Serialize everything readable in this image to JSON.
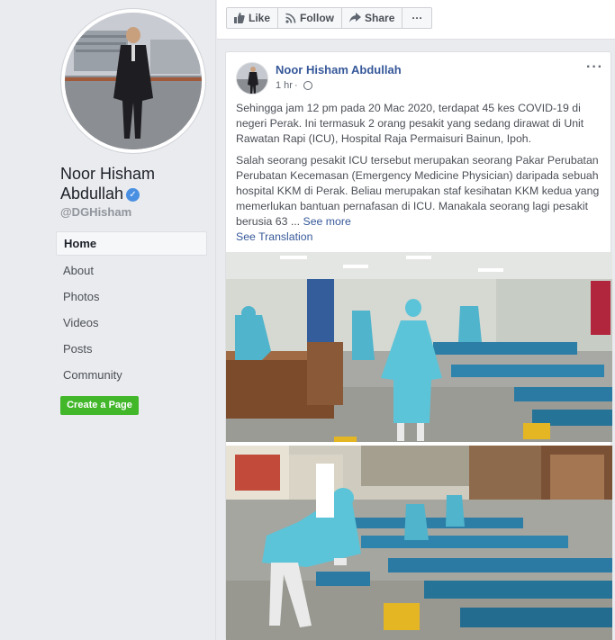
{
  "profile": {
    "name": "Noor Hisham Abdullah",
    "handle": "@DGHisham",
    "verified_icon": "check-icon"
  },
  "nav": {
    "items": [
      {
        "label": "Home",
        "active": true
      },
      {
        "label": "About"
      },
      {
        "label": "Photos"
      },
      {
        "label": "Videos"
      },
      {
        "label": "Posts"
      },
      {
        "label": "Community"
      }
    ],
    "create_page": "Create a Page"
  },
  "actions": {
    "like": "Like",
    "follow": "Follow",
    "share": "Share",
    "more": "···"
  },
  "post": {
    "author": "Noor Hisham Abdullah",
    "time": "1 hr",
    "menu": "···",
    "paragraph1": "Sehingga jam 12 pm pada 20 Mac 2020, terdapat 45 kes COVID-19 di negeri Perak. Ini termasuk 2 orang pesakit yang sedang dirawat di Unit Rawatan Rapi (ICU), Hospital Raja Permaisuri Bainun, Ipoh.",
    "paragraph2": "Salah seorang pesakit ICU tersebut merupakan seorang Pakar Perubatan Perubatan Kecemasan (Emergency Medicine Physician) daripada sebuah hospital KKM di Perak. Beliau merupakan staf kesihatan KKM kedua yang memerlukan bantuan pernafasan di ICU. Manakala seorang lagi pesakit berusia 63 ...",
    "see_more": "See more",
    "see_translation": "See Translation"
  },
  "colors": {
    "link": "#365899",
    "create_button": "#42b72a",
    "background": "#e9ebee",
    "ppe_blue": "#5cc4d8"
  }
}
